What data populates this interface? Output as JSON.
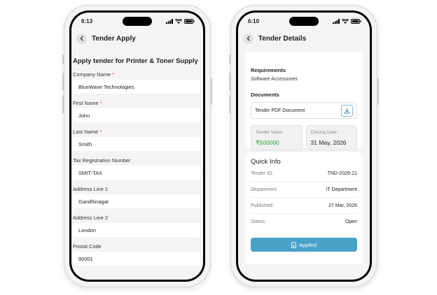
{
  "left_screen": {
    "time": "6:13",
    "header_title": "Tender Apply",
    "form_title": "Apply tender for Printer & Toner Supply",
    "fields": [
      {
        "label": "Company Name",
        "required": "*",
        "value": "BlueWave Technologies"
      },
      {
        "label": "First Name",
        "required": "*",
        "value": "John"
      },
      {
        "label": "Last Name",
        "required": "*",
        "value": "Smith"
      },
      {
        "label": "Tax Registration Number",
        "required": "",
        "value": "SMIT-TAX"
      },
      {
        "label": "Address Line 1",
        "required": "",
        "value": "Gandhinagar"
      },
      {
        "label": "Address Line 2",
        "required": "",
        "value": "London"
      },
      {
        "label": "Postal Code",
        "required": "",
        "value": "90001"
      }
    ]
  },
  "right_screen": {
    "time": "6:10",
    "header_title": "Tender Details",
    "requirements_label": "Requirements",
    "requirements_value": "Software Accessories",
    "documents_label": "Documents",
    "document_name": "Tender PDF Document",
    "tender_value_label": "Tender Value:",
    "tender_value": "₹500000",
    "closing_date_label": "Closing Date:",
    "closing_date": "31 May, 2026",
    "quick_info_title": "Quick Info",
    "quick_info": [
      {
        "key": "Tender ID:",
        "value": "TND-2026-21"
      },
      {
        "key": "Department:",
        "value": "IT Department"
      },
      {
        "key": "Published:",
        "value": "27 Mar, 2026"
      },
      {
        "key": "Status:",
        "value": "Open"
      }
    ],
    "applied_label": "Applied"
  },
  "colors": {
    "accent": "#49a2c7",
    "status_open": "#2e9b3a",
    "tender_value": "#2e9b3a",
    "required_star": "#d64545"
  }
}
